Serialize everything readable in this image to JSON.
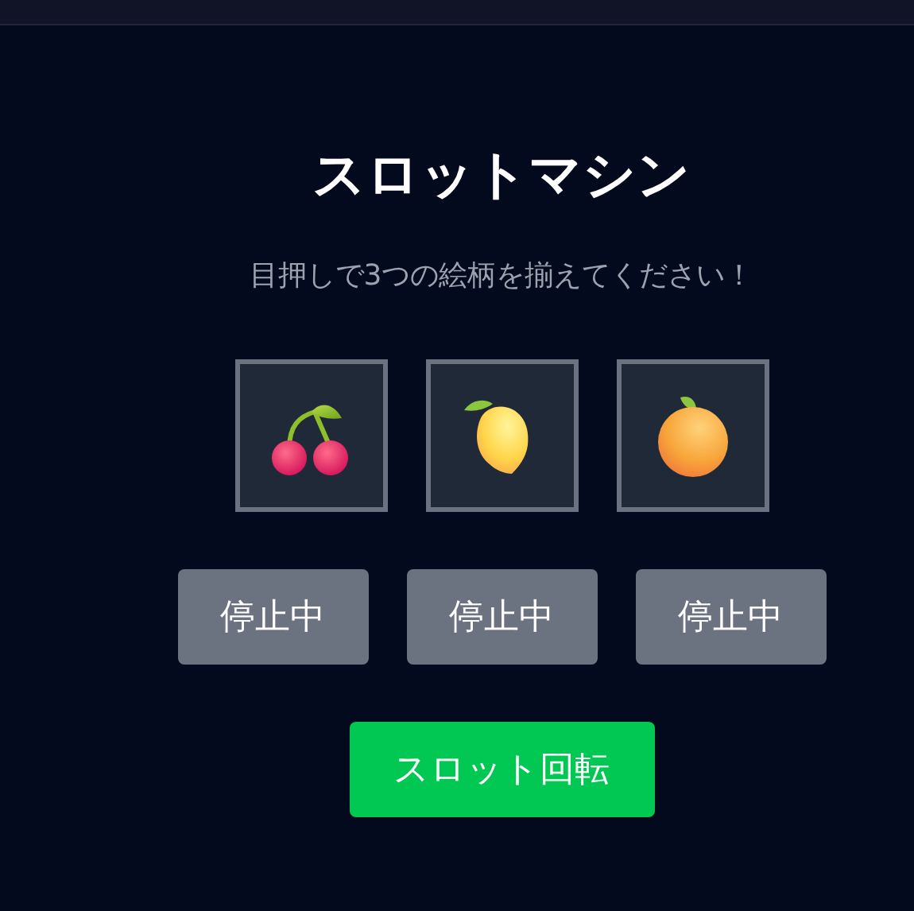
{
  "title": "スロットマシン",
  "instruction": "目押しで3つの絵柄を揃えてください！",
  "reels": [
    {
      "kind": "cherry"
    },
    {
      "kind": "lemon"
    },
    {
      "kind": "orange"
    }
  ],
  "stop_buttons": [
    "停止中",
    "停止中",
    "停止中"
  ],
  "spin_button": "スロット回転"
}
